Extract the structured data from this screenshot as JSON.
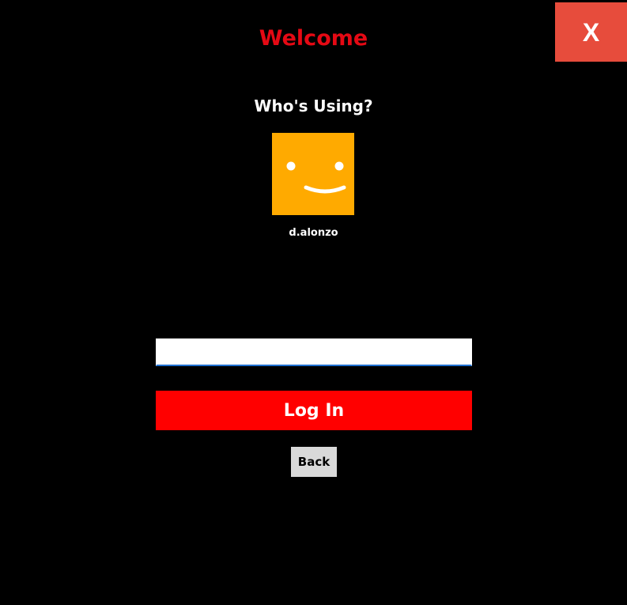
{
  "window": {
    "close_label": "X"
  },
  "header": {
    "title": "Welcome"
  },
  "profiles": {
    "heading": "Who's Using?",
    "items": [
      {
        "name": "d.alonzo",
        "icon": "smiley-face-icon",
        "tile_color": "#FFAA00"
      }
    ]
  },
  "login": {
    "password_value": "",
    "password_placeholder": "",
    "button_label": "Log In",
    "back_label": "Back"
  },
  "colors": {
    "background": "#000000",
    "brand_red": "#FF0000",
    "close_bg": "#E74C3C",
    "title_red": "#E50914",
    "focus_underline": "#1E6FD0",
    "back_bg": "#D9D9D9"
  }
}
